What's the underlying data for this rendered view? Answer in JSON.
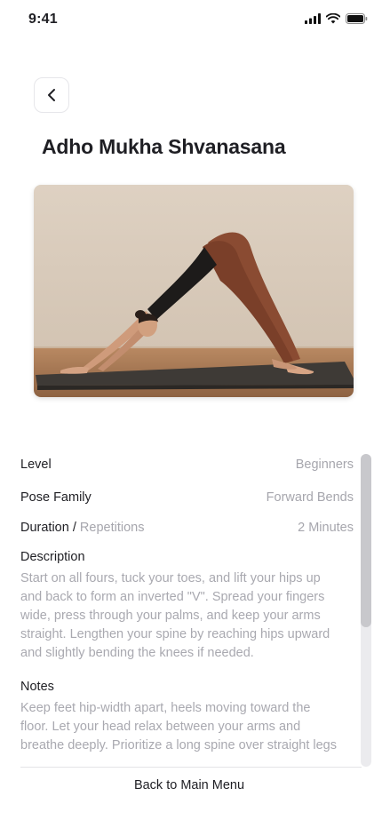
{
  "status": {
    "time": "9:41"
  },
  "header": {
    "title": "Adho Mukha Shvanasana"
  },
  "image": {
    "subject": "woman in downward dog pose on yoga mat"
  },
  "details": {
    "level_label": "Level",
    "level_value": "Beginners",
    "family_label": "Pose Family",
    "family_value": "Forward Bends",
    "duration_label": "Duration / ",
    "repetitions_label": "Repetitions",
    "duration_value": "2 Minutes",
    "description_heading": "Description",
    "description_lines": [
      "Start on all fours, tuck your toes, and lift your hips up",
      "and back to form an inverted \"V\". Spread your fingers",
      "wide, press through your palms, and keep your arms",
      "straight. Lengthen your spine by reaching hips upward",
      "and slightly bending the knees if needed."
    ],
    "notes_heading": "Notes",
    "notes_lines": [
      "Keep feet hip-width apart, heels moving toward the",
      "floor. Let your head relax between your arms and",
      "breathe deeply. Prioritize a long spine over straight legs"
    ]
  },
  "footer": {
    "back_label": "Back to Main Menu"
  },
  "colors": {
    "text": "#1f1f24",
    "muted": "#a6a6ad",
    "border": "#e6e6ea"
  }
}
